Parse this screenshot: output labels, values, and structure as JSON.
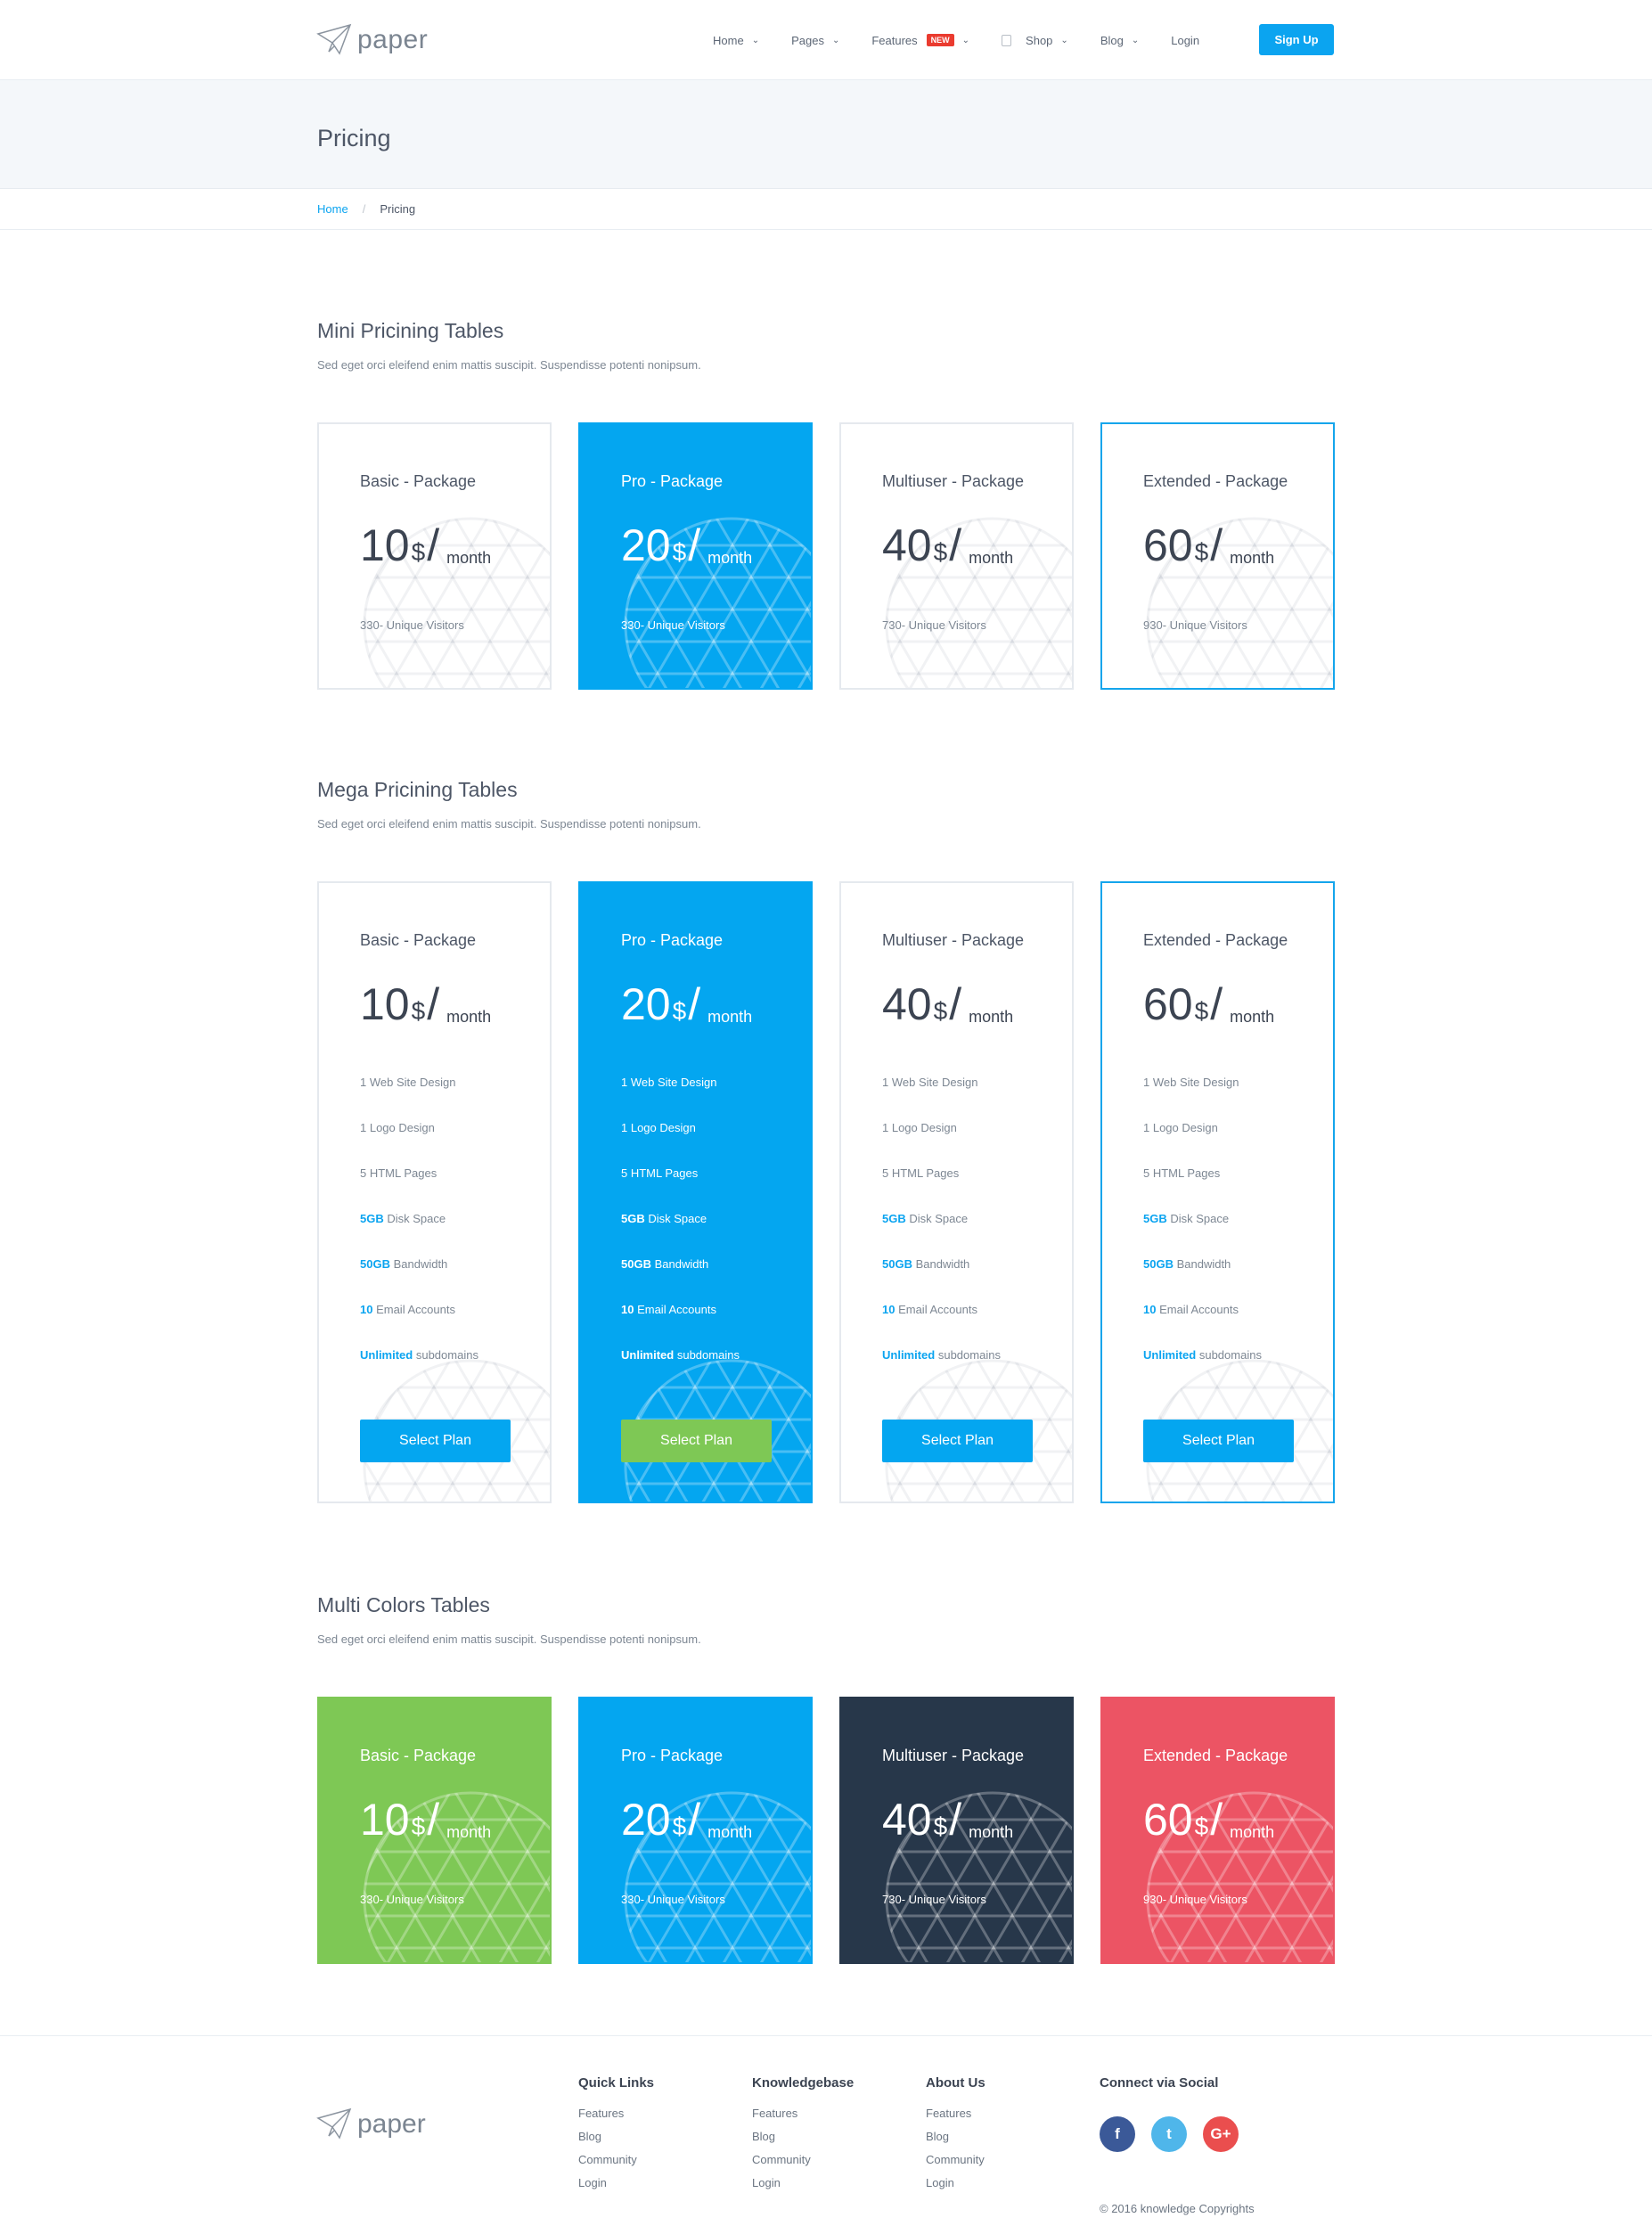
{
  "header": {
    "logo_text": "paper",
    "nav": [
      {
        "label": "Home"
      },
      {
        "label": "Pages"
      },
      {
        "label": "Features",
        "badge": "NEW"
      },
      {
        "label": "Shop"
      },
      {
        "label": "Blog"
      },
      {
        "label": "Login"
      }
    ],
    "signup_label": "Sign Up"
  },
  "page": {
    "title": "Pricing",
    "breadcrumb": {
      "home": "Home",
      "sep": "/",
      "current": "Pricing"
    }
  },
  "sections": {
    "mini": {
      "title": "Mini Pricining Tables",
      "subtitle": "Sed eget orci eleifend enim mattis suscipit. Suspendisse potenti nonipsum."
    },
    "mega": {
      "title": "Mega Pricining Tables",
      "subtitle": "Sed eget orci eleifend enim mattis suscipit. Suspendisse potenti nonipsum."
    },
    "multi": {
      "title": "Multi Colors Tables",
      "subtitle": "Sed eget orci eleifend enim mattis suscipit. Suspendisse potenti nonipsum."
    }
  },
  "packages": [
    {
      "name": "Basic - Package",
      "price": "10",
      "visitors": "330- Unique Visitors"
    },
    {
      "name": "Pro - Package",
      "price": "20",
      "visitors": "330- Unique Visitors"
    },
    {
      "name": "Multiuser - Package",
      "price": "40",
      "visitors": "730- Unique Visitors"
    },
    {
      "name": "Extended - Package",
      "price": "60",
      "visitors": "930- Unique Visitors"
    }
  ],
  "currency": "$",
  "slash": "/",
  "period": "month",
  "mega_features": [
    {
      "hl": "",
      "text": "1 Web Site Design"
    },
    {
      "hl": "",
      "text": "1 Logo Design"
    },
    {
      "hl": "",
      "text": "5 HTML Pages"
    },
    {
      "hl": "5GB",
      "text": " Disk Space"
    },
    {
      "hl": "50GB",
      "text": " Bandwidth"
    },
    {
      "hl": "10",
      "text": " Email Accounts"
    },
    {
      "hl": "Unlimited",
      "text": " subdomains"
    }
  ],
  "select_plan_label": "Select Plan",
  "footer": {
    "logo_text": "paper",
    "columns": [
      {
        "title": "Quick Links",
        "links": [
          "Features",
          "Blog",
          "Community",
          "Login"
        ]
      },
      {
        "title": "Knowledgebase",
        "links": [
          "Features",
          "Blog",
          "Community",
          "Login"
        ]
      },
      {
        "title": "About Us",
        "links": [
          "Features",
          "Blog",
          "Community",
          "Login"
        ]
      }
    ],
    "social_title": "Connect via Social",
    "social": [
      {
        "icon": "facebook-icon",
        "glyph": "f",
        "color": "#3b5998"
      },
      {
        "icon": "twitter-icon",
        "glyph": "t",
        "color": "#4fb6ea"
      },
      {
        "icon": "google-plus-icon",
        "glyph": "G+",
        "color": "#ea4e4e"
      }
    ],
    "copyright": "© 2016 knowledge Copyrights"
  },
  "colors": {
    "accent": "#04a6f0",
    "green": "#7ec855",
    "dark": "#27374a",
    "red": "#ec5464",
    "new_badge": "#ea3b2f"
  }
}
